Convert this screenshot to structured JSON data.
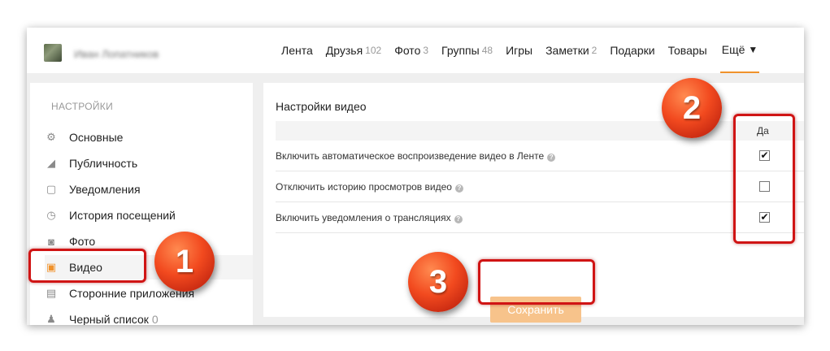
{
  "header": {
    "user_name": "Иван Лопатников",
    "nav": [
      {
        "label": "Лента",
        "count": ""
      },
      {
        "label": "Друзья",
        "count": "102"
      },
      {
        "label": "Фото",
        "count": "3"
      },
      {
        "label": "Группы",
        "count": "48"
      },
      {
        "label": "Игры",
        "count": ""
      },
      {
        "label": "Заметки",
        "count": "2"
      },
      {
        "label": "Подарки",
        "count": ""
      },
      {
        "label": "Товары",
        "count": ""
      }
    ],
    "more_label": "Ещё",
    "more_caret": "▼"
  },
  "sidebar": {
    "title": "НАСТРОЙКИ",
    "items": [
      {
        "label": "Основные",
        "icon": "gear-icon",
        "glyph": "⚙",
        "count": ""
      },
      {
        "label": "Публичность",
        "icon": "megaphone-icon",
        "glyph": "◢",
        "count": ""
      },
      {
        "label": "Уведомления",
        "icon": "notification-icon",
        "glyph": "▢",
        "count": ""
      },
      {
        "label": "История посещений",
        "icon": "history-icon",
        "glyph": "◷",
        "count": ""
      },
      {
        "label": "Фото",
        "icon": "camera-icon",
        "glyph": "◙",
        "count": ""
      },
      {
        "label": "Видео",
        "icon": "film-icon",
        "glyph": "▣",
        "count": ""
      },
      {
        "label": "Сторонние приложения",
        "icon": "apps-icon",
        "glyph": "▤",
        "count": ""
      },
      {
        "label": "Черный список",
        "icon": "blocked-user-icon",
        "glyph": "♟",
        "count": "0"
      }
    ],
    "active_index": 5
  },
  "main": {
    "title": "Настройки видео",
    "column_yes": "Да",
    "help_glyph": "?",
    "rows": [
      {
        "label": "Включить автоматическое воспроизведение видео в Ленте",
        "checked": true
      },
      {
        "label": "Отключить историю просмотров видео",
        "checked": false
      },
      {
        "label": "Включить уведомления о трансляциях",
        "checked": true
      }
    ],
    "save_label": "Сохранить"
  },
  "annotations": {
    "badge1": "1",
    "badge2": "2",
    "badge3": "3"
  },
  "colors": {
    "accent": "#f0922b",
    "save_button": "#f7c38b",
    "highlight": "#d01414",
    "badge": "#f24a1f"
  }
}
